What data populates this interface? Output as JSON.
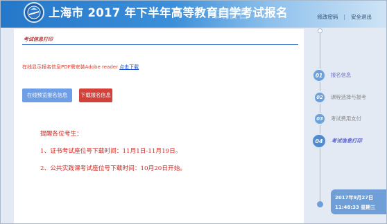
{
  "header": {
    "title": "上海市 2017 年下半年高等教育自学考试报名",
    "title_ghost": "试报名",
    "links": [
      "修改密码",
      "安全退出"
    ],
    "separator": "|"
  },
  "main": {
    "section_title": "考试信息打印",
    "notice_text": "在线显示报名信息PDF需安装Adobe reader ",
    "notice_link": "点击下载",
    "buttons": {
      "preview": "在线预览报名信息",
      "download": "下载报名信息"
    },
    "tips": {
      "heading": "提醒各位考生：",
      "items": [
        "1、证书考试座位号下载时间：11月1日-11月19日。",
        "2、公共实践课考试座位号下载时间：10月20日开始。"
      ]
    }
  },
  "steps": [
    {
      "number": "01",
      "label": "报名信息",
      "state": "done"
    },
    {
      "number": "02",
      "label": "课程选择与报考",
      "state": "pending"
    },
    {
      "number": "03",
      "label": "考试费用支付",
      "state": "pending"
    },
    {
      "number": "04",
      "label": "考试信息打印",
      "state": "active"
    }
  ],
  "clock": {
    "date": "2017年9月27日",
    "time": "11:48:33 星期三"
  },
  "colors": {
    "header_blue": "#2577c9",
    "accent_line": "#3d75c4",
    "preview_button": "#6d9ee6",
    "download_button": "#d2413a",
    "tip_red": "#d3261f",
    "step_badge": "#6da0d9"
  }
}
